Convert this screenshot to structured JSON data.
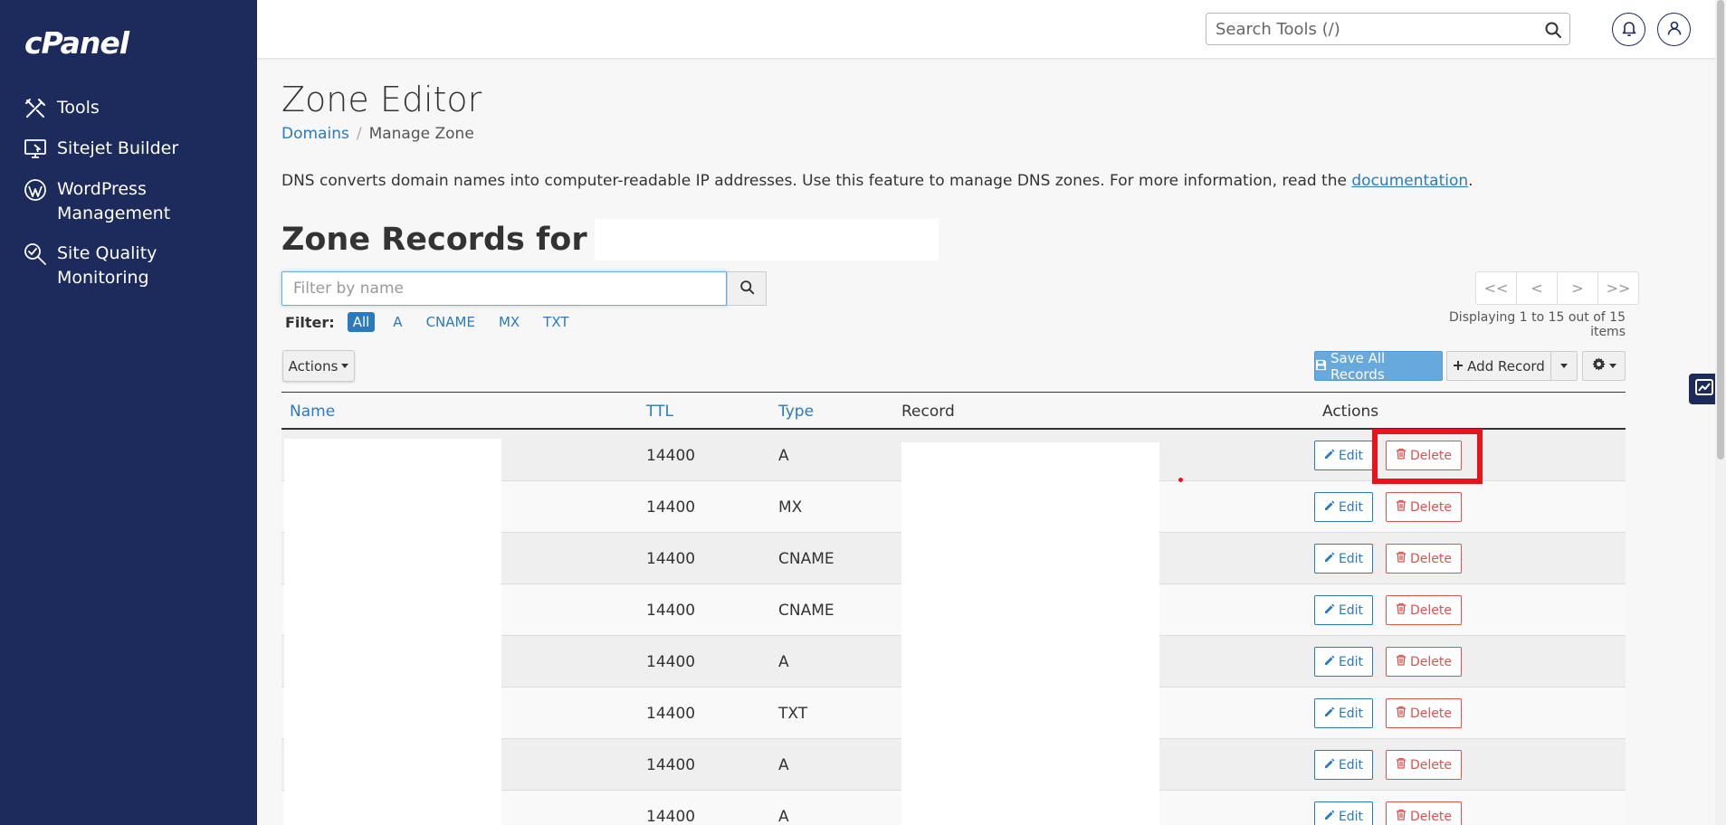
{
  "brand": {
    "logo_text": "cPanel"
  },
  "sidebar": {
    "items": [
      {
        "label": "Tools",
        "icon": "tools-icon"
      },
      {
        "label": "Sitejet Builder",
        "icon": "sitejet-icon"
      },
      {
        "label": "WordPress Management",
        "icon": "wordpress-icon"
      },
      {
        "label": "Site Quality Monitoring",
        "icon": "site-quality-icon"
      }
    ]
  },
  "topbar": {
    "search_placeholder": "Search Tools (/)",
    "icons": [
      "search-icon",
      "bell-icon",
      "user-icon"
    ]
  },
  "page": {
    "title": "Zone Editor",
    "breadcrumb": {
      "link": "Domains",
      "separator": "/",
      "current": "Manage Zone"
    },
    "description": "DNS converts domain names into computer-readable IP addresses. Use this feature to manage DNS zones. For more information, read the ",
    "description_link": "documentation",
    "description_end": ".",
    "zone_heading": "Zone Records for"
  },
  "filter": {
    "placeholder": "Filter by name",
    "label": "Filter:",
    "chips": [
      "All",
      "A",
      "CNAME",
      "MX",
      "TXT"
    ],
    "active": "All"
  },
  "pager": {
    "buttons": [
      "<<",
      "<",
      ">",
      ">>"
    ],
    "status": "Displaying 1 to 15 out of 15 items"
  },
  "toolbar": {
    "actions_label": "Actions",
    "save_all_label": "Save All Records",
    "add_record_label": "Add Record"
  },
  "table": {
    "headers": {
      "name": "Name",
      "ttl": "TTL",
      "type": "Type",
      "record": "Record",
      "actions": "Actions"
    },
    "edit_label": "Edit",
    "delete_label": "Delete",
    "rows": [
      {
        "ttl": "14400",
        "type": "A"
      },
      {
        "ttl": "14400",
        "type": "MX"
      },
      {
        "ttl": "14400",
        "type": "CNAME"
      },
      {
        "ttl": "14400",
        "type": "CNAME"
      },
      {
        "ttl": "14400",
        "type": "A"
      },
      {
        "ttl": "14400",
        "type": "TXT"
      },
      {
        "ttl": "14400",
        "type": "A"
      },
      {
        "ttl": "14400",
        "type": "A"
      }
    ]
  },
  "colors": {
    "sidebar_bg": "#1c2a5c",
    "link": "#2a7abf",
    "danger": "#d9534f",
    "highlight": "#e8131b",
    "primary_btn": "#67a8dd"
  }
}
